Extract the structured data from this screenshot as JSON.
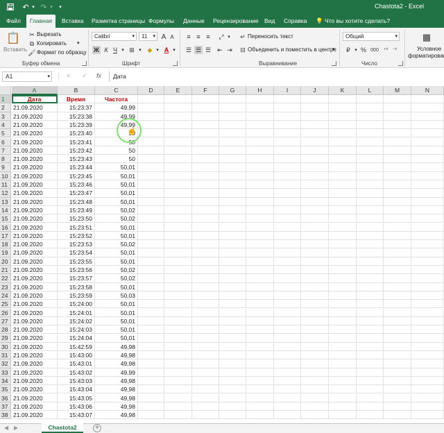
{
  "titlebar": {
    "save_icon": "save-icon",
    "undo_icon": "undo-icon",
    "redo_icon": "redo-icon",
    "title": "Chastota2  -  Excel"
  },
  "tabs": [
    "Файл",
    "Главная",
    "Вставка",
    "Разметка страницы",
    "Формулы",
    "Данные",
    "Рецензирование",
    "Вид",
    "Справка"
  ],
  "active_tab": "Главная",
  "tell_me": "Что вы хотите сделать?",
  "ribbon": {
    "clipboard": {
      "paste": "Вставить",
      "cut": "Вырезать",
      "copy": "Копировать",
      "format_painter": "Формат по образцу",
      "label": "Буфер обмена"
    },
    "font": {
      "name": "Calibri",
      "size": "11",
      "grow": "A",
      "shrink": "A",
      "bold": "Ж",
      "italic": "К",
      "underline": "Ч",
      "label": "Шрифт"
    },
    "alignment": {
      "wrap": "Переносить текст",
      "merge": "Объединить и поместить в центре",
      "label": "Выравнивание"
    },
    "number": {
      "format": "Общий",
      "percent": "%",
      "thousands": "000",
      "label": "Число"
    },
    "styles": {
      "conditional_line1": "Условное",
      "conditional_line2": "форматирован"
    }
  },
  "formula_bar": {
    "name_box": "A1",
    "cancel": "×",
    "enter": "✓",
    "fx": "fx",
    "content": "Дата"
  },
  "columns": [
    "A",
    "B",
    "C",
    "D",
    "E",
    "F",
    "G",
    "H",
    "I",
    "J",
    "K",
    "L",
    "M",
    "N"
  ],
  "header_row": {
    "date": "Дата",
    "time": "Время",
    "freq": "Частота"
  },
  "rows": [
    {
      "n": "2",
      "date": "21.09.2020",
      "time": "15:23:37",
      "freq": "49,99"
    },
    {
      "n": "3",
      "date": "21.09.2020",
      "time": "15:23:38",
      "freq": "49,99"
    },
    {
      "n": "4",
      "date": "21.09.2020",
      "time": "15:23:39",
      "freq": "49,99"
    },
    {
      "n": "5",
      "date": "21.09.2020",
      "time": "15:23:40",
      "freq": "50"
    },
    {
      "n": "6",
      "date": "21.09.2020",
      "time": "15:23:41",
      "freq": "50"
    },
    {
      "n": "7",
      "date": "21.09.2020",
      "time": "15:23:42",
      "freq": "50"
    },
    {
      "n": "8",
      "date": "21.09.2020",
      "time": "15:23:43",
      "freq": "50"
    },
    {
      "n": "9",
      "date": "21.09.2020",
      "time": "15:23:44",
      "freq": "50,01"
    },
    {
      "n": "10",
      "date": "21.09.2020",
      "time": "15:23:45",
      "freq": "50,01"
    },
    {
      "n": "11",
      "date": "21.09.2020",
      "time": "15:23:46",
      "freq": "50,01"
    },
    {
      "n": "12",
      "date": "21.09.2020",
      "time": "15:23:47",
      "freq": "50,01"
    },
    {
      "n": "13",
      "date": "21.09.2020",
      "time": "15:23:48",
      "freq": "50,01"
    },
    {
      "n": "14",
      "date": "21.09.2020",
      "time": "15:23:49",
      "freq": "50,02"
    },
    {
      "n": "15",
      "date": "21.09.2020",
      "time": "15:23:50",
      "freq": "50,02"
    },
    {
      "n": "16",
      "date": "21.09.2020",
      "time": "15:23:51",
      "freq": "50,01"
    },
    {
      "n": "17",
      "date": "21.09.2020",
      "time": "15:23:52",
      "freq": "50,01"
    },
    {
      "n": "18",
      "date": "21.09.2020",
      "time": "15:23:53",
      "freq": "50,02"
    },
    {
      "n": "19",
      "date": "21.09.2020",
      "time": "15:23:54",
      "freq": "50,01"
    },
    {
      "n": "20",
      "date": "21.09.2020",
      "time": "15:23:55",
      "freq": "50,01"
    },
    {
      "n": "21",
      "date": "21.09.2020",
      "time": "15:23:56",
      "freq": "50,02"
    },
    {
      "n": "22",
      "date": "21.09.2020",
      "time": "15:23:57",
      "freq": "50,02"
    },
    {
      "n": "23",
      "date": "21.09.2020",
      "time": "15:23:58",
      "freq": "50,01"
    },
    {
      "n": "24",
      "date": "21.09.2020",
      "time": "15:23:59",
      "freq": "50,03"
    },
    {
      "n": "25",
      "date": "21.09.2020",
      "time": "15:24:00",
      "freq": "50,01"
    },
    {
      "n": "26",
      "date": "21.09.2020",
      "time": "15:24:01",
      "freq": "50,01"
    },
    {
      "n": "27",
      "date": "21.09.2020",
      "time": "15:24:02",
      "freq": "50,01"
    },
    {
      "n": "28",
      "date": "21.09.2020",
      "time": "15:24:03",
      "freq": "50,01"
    },
    {
      "n": "29",
      "date": "21.09.2020",
      "time": "15:24:04",
      "freq": "50,01"
    },
    {
      "n": "30",
      "date": "21.09.2020",
      "time": "15:42:59",
      "freq": "49,98"
    },
    {
      "n": "31",
      "date": "21.09.2020",
      "time": "15:43:00",
      "freq": "49,98"
    },
    {
      "n": "32",
      "date": "21.09.2020",
      "time": "15:43:01",
      "freq": "49,98"
    },
    {
      "n": "33",
      "date": "21.09.2020",
      "time": "15:43:02",
      "freq": "49,99"
    },
    {
      "n": "34",
      "date": "21.09.2020",
      "time": "15:43:03",
      "freq": "49,98"
    },
    {
      "n": "35",
      "date": "21.09.2020",
      "time": "15:43:04",
      "freq": "49,98"
    },
    {
      "n": "36",
      "date": "21.09.2020",
      "time": "15:43:05",
      "freq": "49,98"
    },
    {
      "n": "37",
      "date": "21.09.2020",
      "time": "15:43:06",
      "freq": "49,98"
    },
    {
      "n": "38",
      "date": "21.09.2020",
      "time": "15:43:07",
      "freq": "49,98"
    }
  ],
  "sheet_tab": "Chastota2",
  "add_sheet": "+",
  "accent_color": "#217346",
  "header_text_color": "#c00000"
}
